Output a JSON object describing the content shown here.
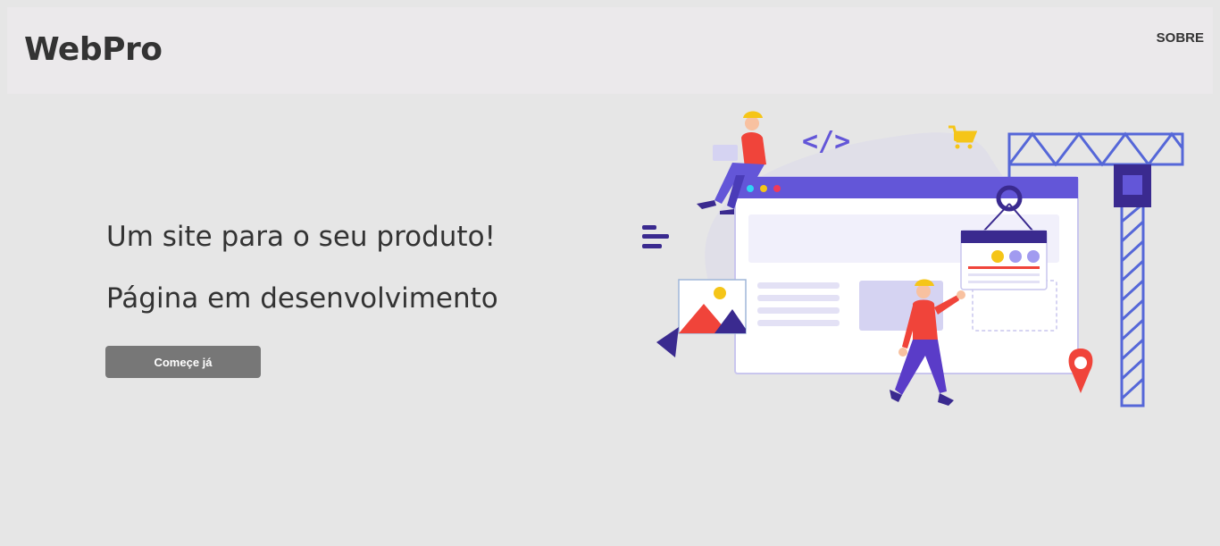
{
  "header": {
    "logo_text": "WebPro",
    "nav_about": "SOBRE"
  },
  "hero": {
    "title": "Um site para o seu produto!",
    "subtitle": "Página em desenvolvimento",
    "cta_label": "Começe já"
  },
  "illustration": {
    "code_symbol": "</>",
    "icon": "website-under-construction-illustration"
  },
  "colors": {
    "page_bg": "#e6e6e6",
    "header_bg": "#ebe9eb",
    "button_bg": "#777777",
    "accent_purple": "#6356d8",
    "accent_red": "#f0443a",
    "accent_yellow": "#f5c518"
  }
}
